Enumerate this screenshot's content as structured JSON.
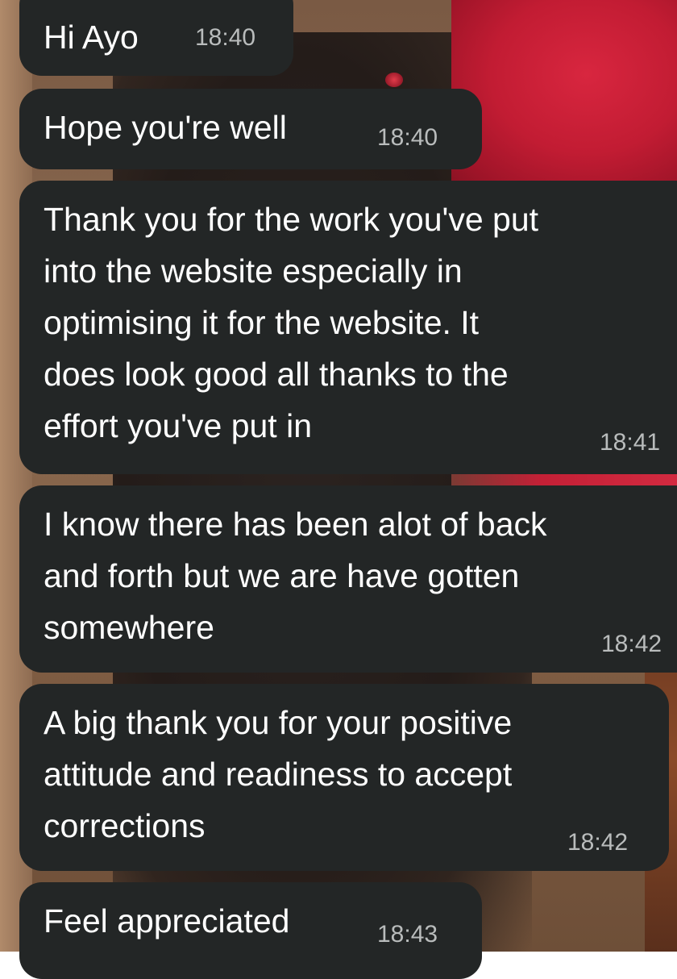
{
  "chat": {
    "messages": [
      {
        "text": "Hi Ayo",
        "time": "18:40"
      },
      {
        "text": "Hope you're well",
        "time": "18:40"
      },
      {
        "text": "Thank you for the work you've put\ninto the website especially in\noptimising it for the website. It\ndoes look good all thanks to the\neffort you've put in",
        "time": "18:41"
      },
      {
        "text": "I know there has been alot of back\nand forth but we are have gotten\nsomewhere",
        "time": "18:42"
      },
      {
        "text": "A big thank you for your positive\nattitude and readiness to accept\ncorrections",
        "time": "18:42"
      },
      {
        "text": "Feel appreciated",
        "time": "18:43"
      }
    ]
  },
  "theme": {
    "bubble_color": "#232626",
    "text_color": "#ffffff",
    "time_color": "#b9bcbc"
  }
}
